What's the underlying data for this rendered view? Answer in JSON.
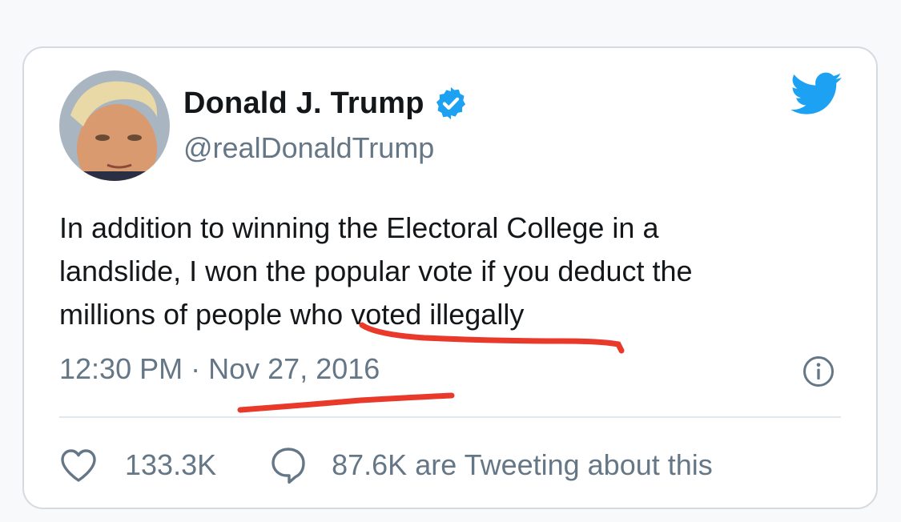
{
  "tweet": {
    "display_name": "Donald J. Trump",
    "handle": "@realDonaldTrump",
    "text_lines": [
      "In addition to winning the Electoral College in a",
      "landslide, I won the popular vote if you deduct the",
      "millions of people who voted illegally"
    ],
    "time": "12:30 PM",
    "separator": "·",
    "date": "Nov 27, 2016",
    "likes": "133.3K",
    "tweeting_about": "87.6K are Tweeting about this"
  },
  "icons": {
    "verified": "verified-badge-icon",
    "bird": "twitter-bird-icon",
    "info": "info-icon",
    "like": "heart-icon",
    "reply": "speech-bubble-icon"
  },
  "colors": {
    "twitter_blue": "#1da1f2",
    "text_primary": "#14171a",
    "text_secondary": "#657786",
    "annotation_red": "#e8392b"
  }
}
